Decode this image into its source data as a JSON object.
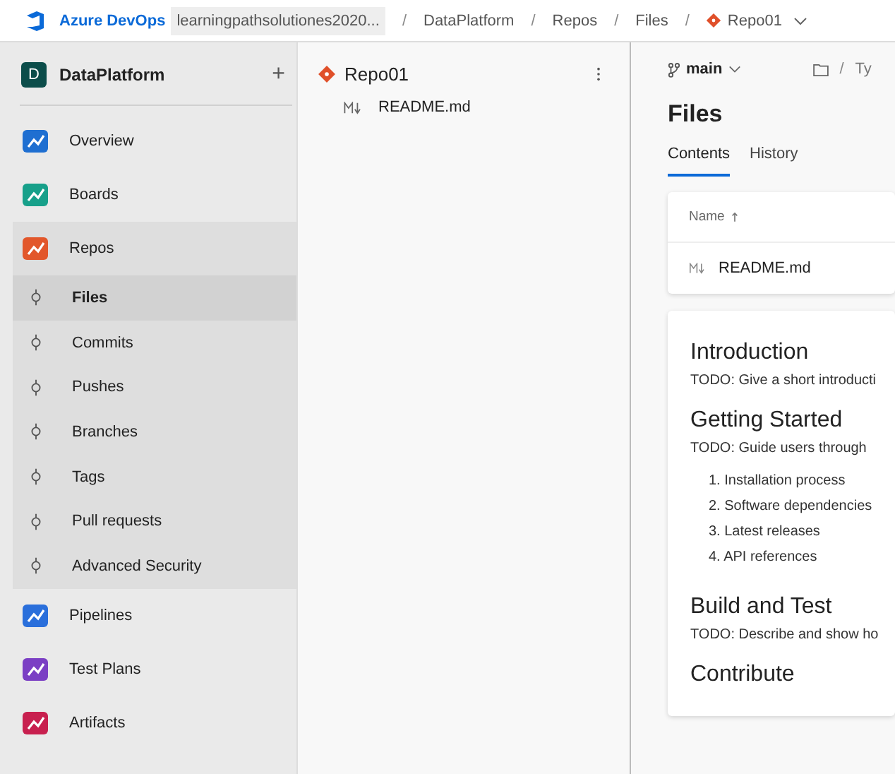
{
  "topbar": {
    "brand": "Azure DevOps",
    "organization": "learningpathsolutiones2020...",
    "breadcrumbs": [
      {
        "separator": "/",
        "label": "DataPlatform"
      },
      {
        "separator": "/",
        "label": "Repos"
      },
      {
        "separator": "/",
        "label": "Files"
      },
      {
        "separator": "/",
        "label": "Repo01"
      }
    ]
  },
  "sidebar": {
    "project": {
      "initial": "D",
      "name": "DataPlatform",
      "add": "+"
    },
    "items": [
      {
        "label": "Overview",
        "selected": false
      },
      {
        "label": "Boards",
        "selected": false
      },
      {
        "label": "Repos",
        "selected": false,
        "expanded": true,
        "children": [
          {
            "label": "Files",
            "selected": true
          },
          {
            "label": "Commits",
            "selected": false
          },
          {
            "label": "Pushes",
            "selected": false
          },
          {
            "label": "Branches",
            "selected": false
          },
          {
            "label": "Tags",
            "selected": false
          },
          {
            "label": "Pull requests",
            "selected": false
          },
          {
            "label": "Advanced Security",
            "selected": false
          }
        ]
      },
      {
        "label": "Pipelines",
        "selected": false
      },
      {
        "label": "Test Plans",
        "selected": false
      },
      {
        "label": "Artifacts",
        "selected": false
      }
    ]
  },
  "tree": {
    "repo": "Repo01",
    "files": [
      {
        "name": "README.md",
        "selected": false
      }
    ]
  },
  "content": {
    "branch": "main",
    "path_separator": "/",
    "path": "Ty",
    "title": "Files",
    "tabs": [
      {
        "label": "Contents",
        "selected": true
      },
      {
        "label": "History",
        "selected": false
      }
    ],
    "table": {
      "column": "Name",
      "rows": [
        "README.md"
      ]
    },
    "readme": [
      {
        "heading": "Introduction",
        "text": "TODO: Give a short introducti"
      },
      {
        "heading": "Getting Started",
        "text": "TODO: Guide users through",
        "list": [
          "1. Installation process",
          "2. Software dependencies",
          "3. Latest releases",
          "4. API references"
        ]
      },
      {
        "heading": "Build and Test",
        "text": "TODO: Describe and show ho"
      },
      {
        "heading": "Contribute"
      }
    ]
  }
}
